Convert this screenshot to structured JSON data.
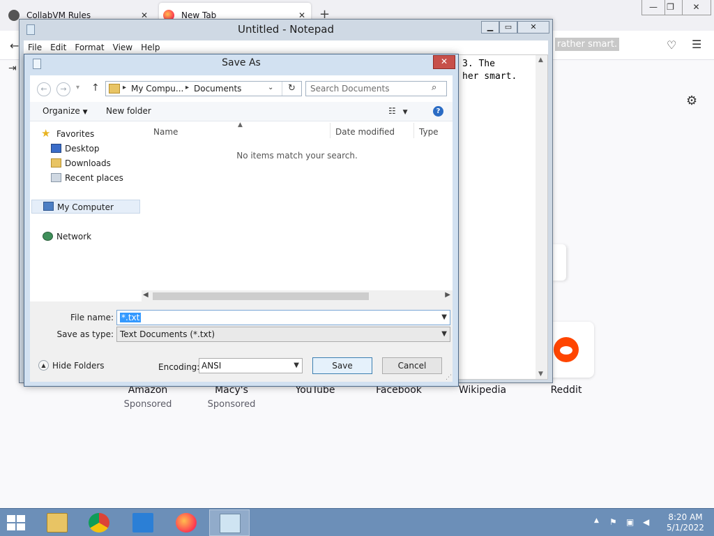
{
  "firefox": {
    "tabs": [
      {
        "title": "CollabVM Rules"
      },
      {
        "title": "New Tab"
      }
    ],
    "new_tab_symbol": "+",
    "selected_text": "rather smart.",
    "sites": [
      {
        "name": "Amazon",
        "sub": "Sponsored"
      },
      {
        "name": "Macy's",
        "sub": "Sponsored"
      },
      {
        "name": "YouTube",
        "sub": ""
      },
      {
        "name": "Facebook",
        "sub": ""
      },
      {
        "name": "Wikipedia",
        "sub": ""
      },
      {
        "name": "Reddit",
        "sub": ""
      }
    ]
  },
  "notepad": {
    "title": "Untitled - Notepad",
    "menu": [
      "File",
      "Edit",
      "Format",
      "View",
      "Help"
    ],
    "text_line1": "3. The",
    "text_line2": "her smart."
  },
  "dialog": {
    "title": "Save As",
    "address": {
      "root": "My Compu...",
      "folder": "Documents"
    },
    "search_placeholder": "Search Documents",
    "toolbar": {
      "organize": "Organize",
      "new_folder": "New folder"
    },
    "nav": {
      "favorites": "Favorites",
      "desktop": "Desktop",
      "downloads": "Downloads",
      "recent": "Recent places",
      "computer": "My Computer",
      "network": "Network"
    },
    "columns": {
      "name": "Name",
      "date": "Date modified",
      "type": "Type"
    },
    "empty_message": "No items match your search.",
    "file_name_label": "File name:",
    "file_name_value": "*.txt",
    "save_type_label": "Save as type:",
    "save_type_value": "Text Documents (*.txt)",
    "hide_folders": "Hide Folders",
    "encoding_label": "Encoding:",
    "encoding_value": "ANSI",
    "save_button": "Save",
    "cancel_button": "Cancel"
  },
  "taskbar": {
    "time": "8:20 AM",
    "date": "5/1/2022"
  }
}
